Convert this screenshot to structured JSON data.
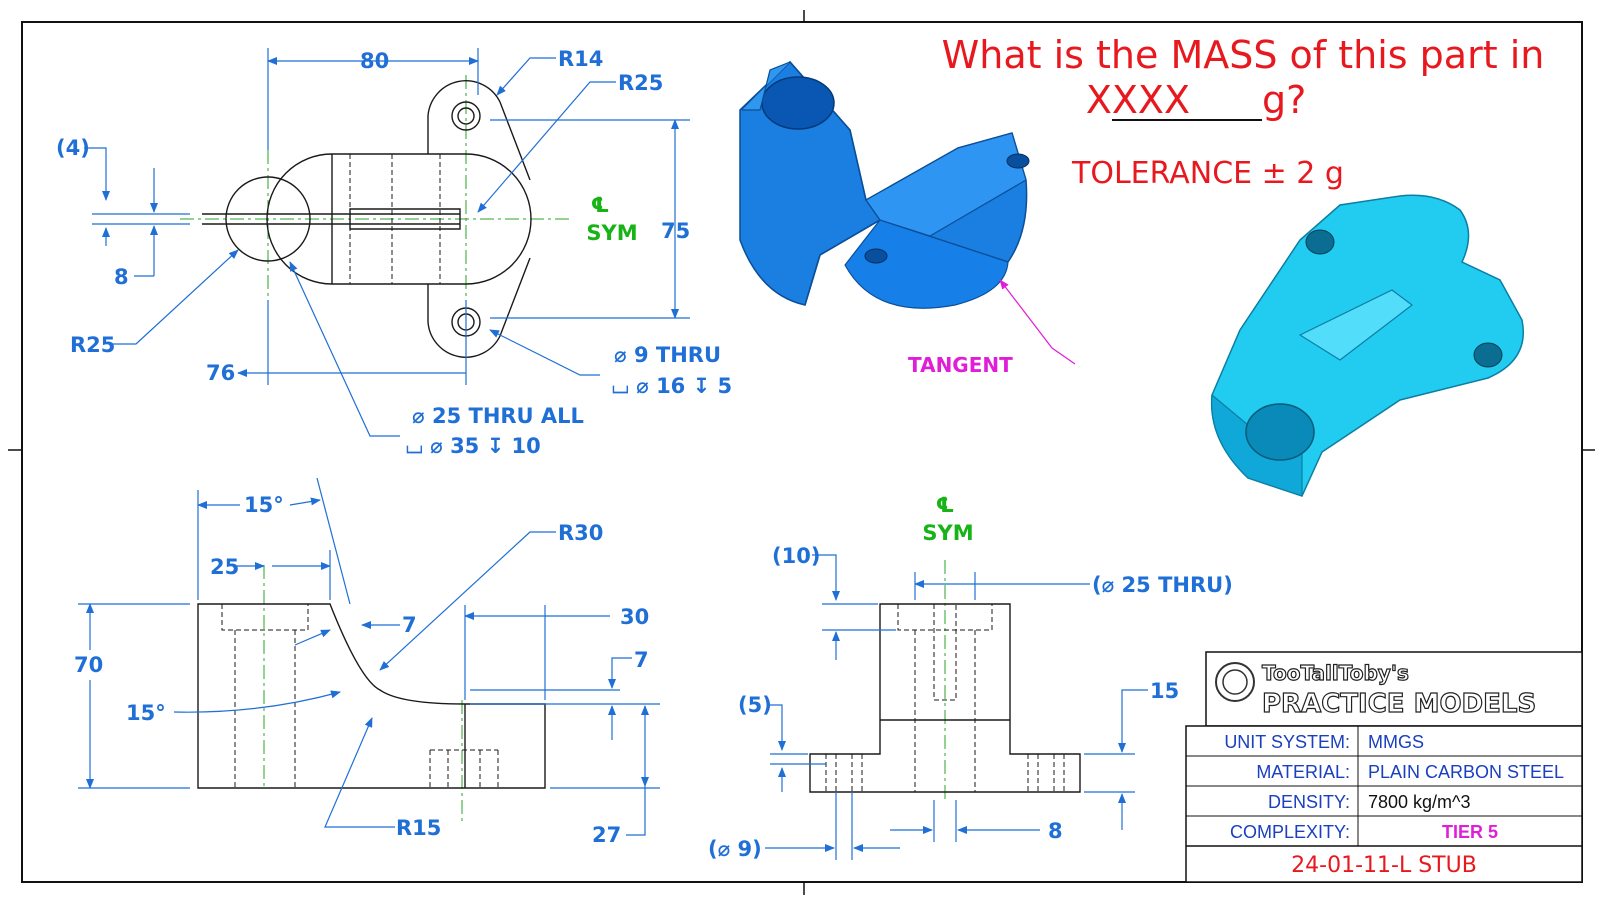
{
  "question": {
    "line1": "What is the MASS of this part in",
    "blank": "XXXX",
    "unit": " g?",
    "tolerance": "TOLERANCE ± 2 g"
  },
  "top_view": {
    "dim_80": "80",
    "dim_r14": "R14",
    "dim_r25_top": "R25",
    "dim_4": "(4)",
    "dim_8": "8",
    "dim_r25_left": "R25",
    "dim_76": "76",
    "dim_75": "75",
    "cl_symbol": "℄",
    "sym": "SYM",
    "hole_9": "⌀ 9 THRU",
    "cbore_16": "⌴ ⌀ 16 ↧ 5",
    "hole_25": "⌀ 25 THRU ALL",
    "cbore_35": "⌴ ⌀ 35 ↧ 10"
  },
  "iso_view": {
    "tangent": "TANGENT"
  },
  "front_view": {
    "dim_15deg_top": "15°",
    "dim_25": "25",
    "dim_70": "70",
    "dim_15deg_left": "15°",
    "dim_7_a": "7",
    "dim_r30": "R30",
    "dim_30": "30",
    "dim_7_b": "7",
    "dim_r15": "R15",
    "dim_27": "27"
  },
  "side_view": {
    "cl_symbol": "℄",
    "sym": "SYM",
    "dim_10": "(10)",
    "dim_25thru": "(⌀ 25 THRU)",
    "dim_5": "(5)",
    "dim_15": "15",
    "dim_9": "(⌀ 9)",
    "dim_8": "8"
  },
  "title_block": {
    "brand_line1": "TooTallToby's",
    "brand_line2": "PRACTICE MODELS",
    "rows": [
      {
        "label": "UNIT SYSTEM:",
        "value": "MMGS"
      },
      {
        "label": "MATERIAL:",
        "value": "PLAIN CARBON STEEL"
      },
      {
        "label": "DENSITY:",
        "value": "7800 kg/m^3"
      },
      {
        "label": "COMPLEXITY:",
        "value": "TIER 5"
      }
    ],
    "part_id": "24-01-11-L STUB"
  },
  "colors": {
    "dimension_blue": "#1f6fd6",
    "question_red": "#e8191e",
    "centerline_green": "#2aa52a",
    "tangent_magenta": "#e01ed8",
    "iso_blue_dark": "#1a7fe0",
    "iso_cyan": "#22ccf0",
    "tier_magenta": "#e01ed8"
  }
}
